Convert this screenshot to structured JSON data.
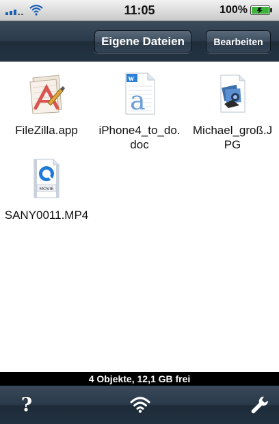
{
  "status_bar": {
    "time": "11:05",
    "battery": "100%",
    "icons": [
      "signal-icon",
      "wifi-icon",
      "battery-icon"
    ]
  },
  "nav": {
    "title_button": "Eigene Dateien",
    "edit_button": "Bearbeiten"
  },
  "files": [
    {
      "name": "FileZilla.app",
      "icon": "app-icon"
    },
    {
      "name": "iPhone4_to_do.doc",
      "icon": "doc-icon"
    },
    {
      "name": "Michael_groß.JPG",
      "icon": "image-icon"
    },
    {
      "name": "SANY0011.MP4",
      "icon": "movie-icon",
      "badge": "MOVIE"
    }
  ],
  "footer": {
    "info": "4 Objekte, 12,1 GB frei",
    "help": "?",
    "toolbar_icons": [
      "help-icon",
      "wifi-icon",
      "wrench-icon"
    ]
  },
  "colors": {
    "nav_dark": "#243342",
    "doc_blue": "#2f7fd6",
    "movie_blue": "#1e7ad8"
  }
}
